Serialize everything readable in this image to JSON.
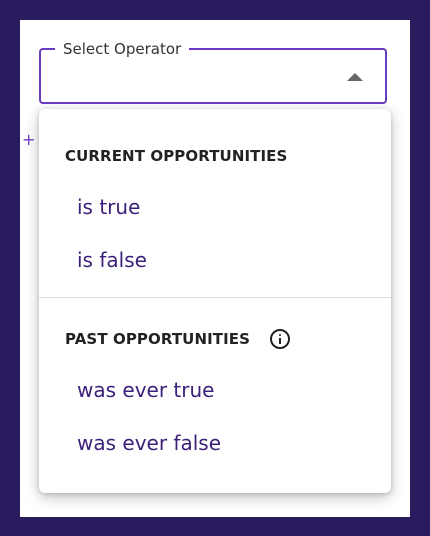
{
  "select": {
    "label": "Select Operator",
    "value": ""
  },
  "side_marker": "+",
  "menu": {
    "groups": [
      {
        "header": "CURRENT OPPORTUNITIES",
        "options": [
          "is true",
          "is false"
        ]
      },
      {
        "header": "PAST OPPORTUNITIES",
        "options": [
          "was ever true",
          "was ever false"
        ]
      }
    ]
  },
  "colors": {
    "background": "#2a1a5e",
    "accent": "#6a3bc4",
    "option_text": "#3b1f78"
  }
}
